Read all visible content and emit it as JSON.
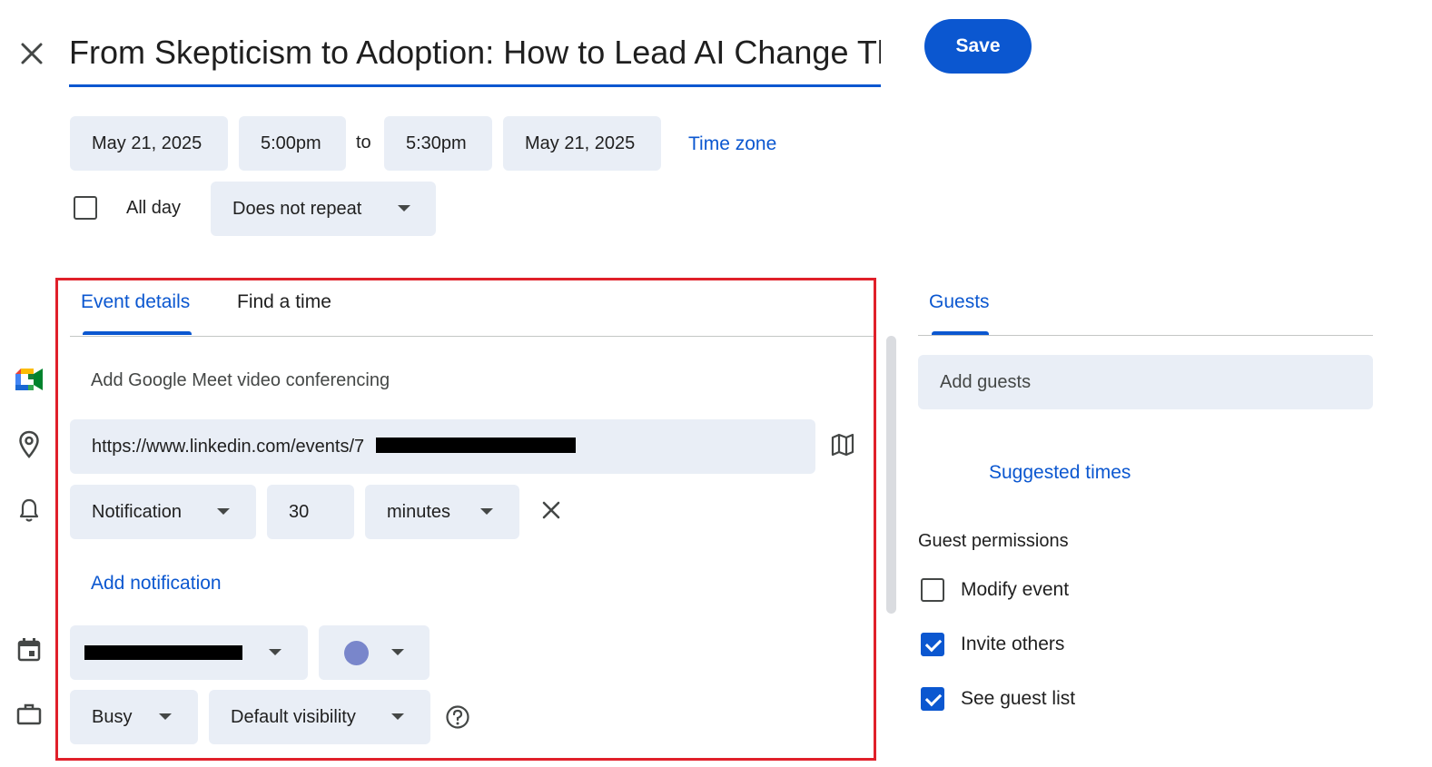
{
  "header": {
    "title": "From Skepticism to Adoption: How to Lead AI Change Th",
    "save_label": "Save"
  },
  "datetime": {
    "start_date": "May 21, 2025",
    "start_time": "5:00pm",
    "to_label": "to",
    "end_time": "5:30pm",
    "end_date": "May 21, 2025",
    "time_zone_label": "Time zone",
    "all_day_label": "All day",
    "repeat_value": "Does not repeat"
  },
  "tabs": {
    "event_details": "Event details",
    "find_a_time": "Find a time",
    "guests": "Guests"
  },
  "details": {
    "meet_label": "Add Google Meet video conferencing",
    "location_value": "https://www.linkedin.com/events/7",
    "notification_type": "Notification",
    "notification_amount": "30",
    "notification_unit": "minutes",
    "add_notification_label": "Add notification",
    "event_color": "#7986cb",
    "availability": "Busy",
    "visibility": "Default visibility"
  },
  "guests_panel": {
    "add_guests_placeholder": "Add guests",
    "suggested_times_label": "Suggested times",
    "permissions_heading": "Guest permissions",
    "permissions": [
      {
        "label": "Modify event",
        "checked": false
      },
      {
        "label": "Invite others",
        "checked": true
      },
      {
        "label": "See guest list",
        "checked": true
      }
    ]
  },
  "colors": {
    "accent": "#0b57d0",
    "chip_bg": "#e9eef6",
    "highlight_border": "#e0202a"
  }
}
